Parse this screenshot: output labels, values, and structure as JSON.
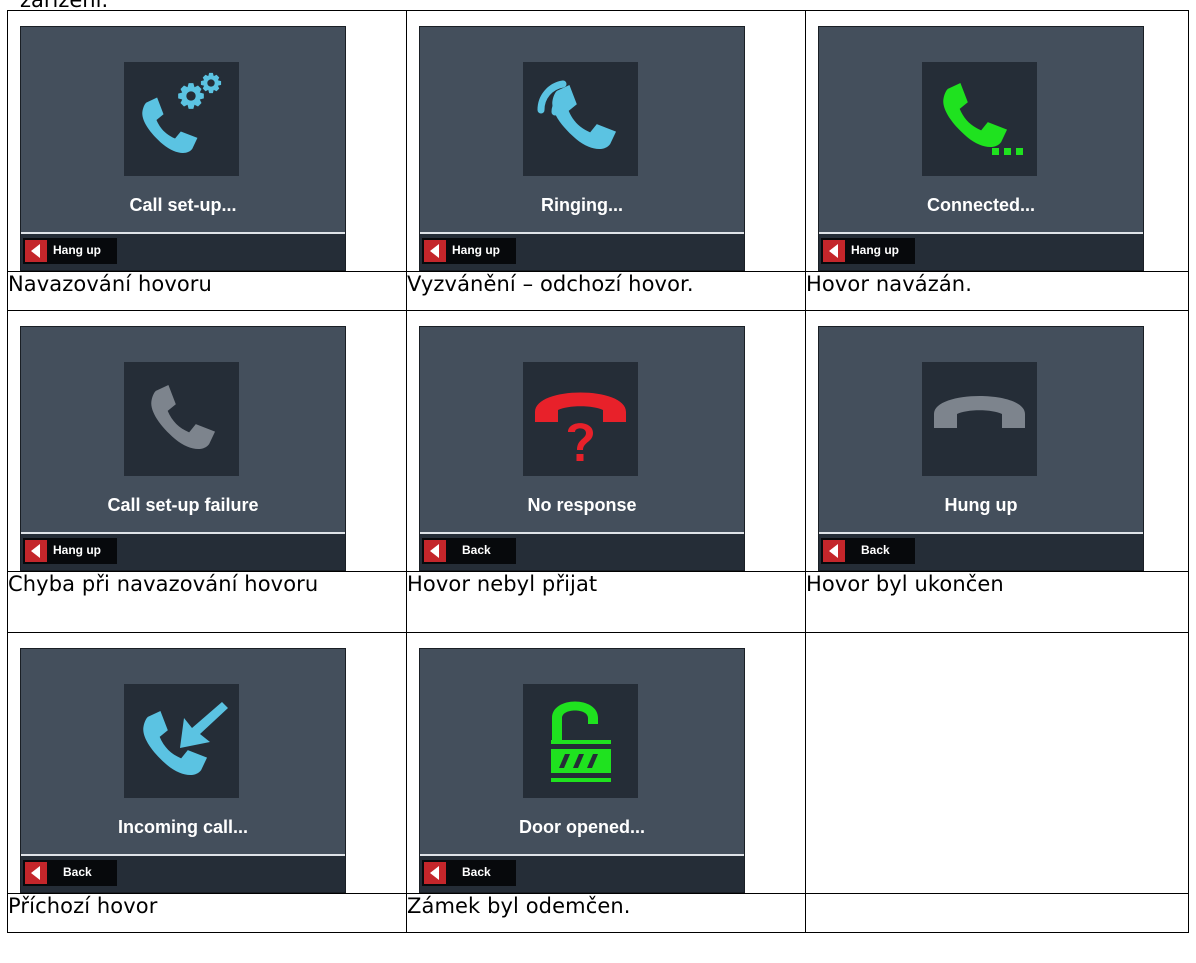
{
  "intro_fragment": "zařízení.",
  "colors": {
    "screen_bg": "#444f5c",
    "icon_bg": "#252d37",
    "cyan_icon": "#5bc3e2",
    "green_icon": "#1fe21f",
    "red_icon": "#e8212a",
    "grey_icon": "#7d848d",
    "button_arrow": "#c4262b"
  },
  "states": [
    {
      "label": "Call set-up...",
      "button": "Hang up",
      "icon": "phone-gear-icon",
      "caption": "Navazování hovoru"
    },
    {
      "label": "Ringing...",
      "button": "Hang up",
      "icon": "phone-ringing-icon",
      "caption": "Vyzvánění – odchozí hovor."
    },
    {
      "label": "Connected...",
      "button": "Hang up",
      "icon": "phone-connected-icon",
      "caption": "Hovor navázán."
    },
    {
      "label": "Call set-up failure",
      "button": "Hang up",
      "icon": "phone-failure-icon",
      "caption": "Chyba při navazování hovoru"
    },
    {
      "label": "No response",
      "button": "Back",
      "icon": "phone-no-response-icon",
      "caption": "Hovor nebyl přijat"
    },
    {
      "label": "Hung up",
      "button": "Back",
      "icon": "phone-hung-up-icon",
      "caption": "Hovor byl ukončen"
    },
    {
      "label": "Incoming call...",
      "button": "Back",
      "icon": "phone-incoming-icon",
      "caption": "Příchozí hovor"
    },
    {
      "label": "Door opened...",
      "button": "Back",
      "icon": "unlocked-padlock-icon",
      "caption": "Zámek byl odemčen."
    }
  ]
}
